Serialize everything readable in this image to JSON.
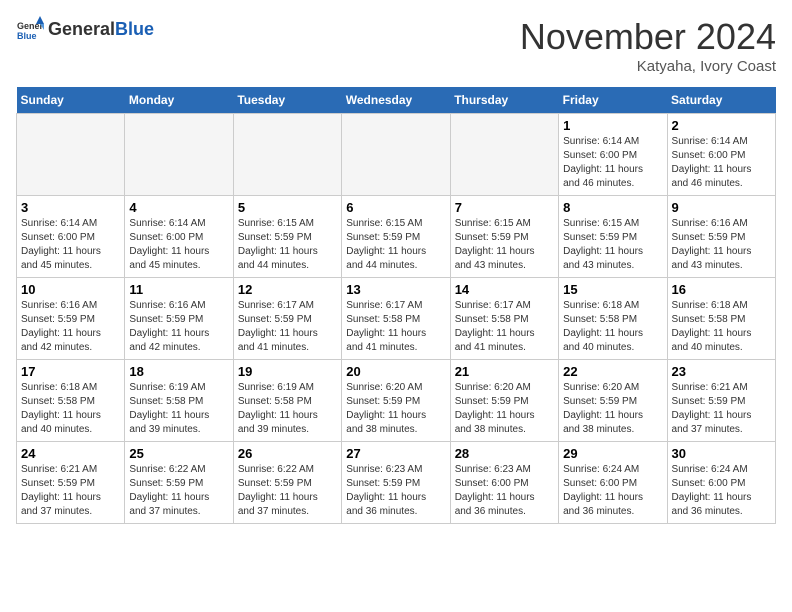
{
  "header": {
    "logo_line1": "General",
    "logo_line2": "Blue",
    "month": "November 2024",
    "location": "Katyaha, Ivory Coast"
  },
  "days_of_week": [
    "Sunday",
    "Monday",
    "Tuesday",
    "Wednesday",
    "Thursday",
    "Friday",
    "Saturday"
  ],
  "weeks": [
    [
      {
        "day": "",
        "empty": true
      },
      {
        "day": "",
        "empty": true
      },
      {
        "day": "",
        "empty": true
      },
      {
        "day": "",
        "empty": true
      },
      {
        "day": "",
        "empty": true
      },
      {
        "day": "1",
        "info": "Sunrise: 6:14 AM\nSunset: 6:00 PM\nDaylight: 11 hours\nand 46 minutes."
      },
      {
        "day": "2",
        "info": "Sunrise: 6:14 AM\nSunset: 6:00 PM\nDaylight: 11 hours\nand 46 minutes."
      }
    ],
    [
      {
        "day": "3",
        "info": "Sunrise: 6:14 AM\nSunset: 6:00 PM\nDaylight: 11 hours\nand 45 minutes."
      },
      {
        "day": "4",
        "info": "Sunrise: 6:14 AM\nSunset: 6:00 PM\nDaylight: 11 hours\nand 45 minutes."
      },
      {
        "day": "5",
        "info": "Sunrise: 6:15 AM\nSunset: 5:59 PM\nDaylight: 11 hours\nand 44 minutes."
      },
      {
        "day": "6",
        "info": "Sunrise: 6:15 AM\nSunset: 5:59 PM\nDaylight: 11 hours\nand 44 minutes."
      },
      {
        "day": "7",
        "info": "Sunrise: 6:15 AM\nSunset: 5:59 PM\nDaylight: 11 hours\nand 43 minutes."
      },
      {
        "day": "8",
        "info": "Sunrise: 6:15 AM\nSunset: 5:59 PM\nDaylight: 11 hours\nand 43 minutes."
      },
      {
        "day": "9",
        "info": "Sunrise: 6:16 AM\nSunset: 5:59 PM\nDaylight: 11 hours\nand 43 minutes."
      }
    ],
    [
      {
        "day": "10",
        "info": "Sunrise: 6:16 AM\nSunset: 5:59 PM\nDaylight: 11 hours\nand 42 minutes."
      },
      {
        "day": "11",
        "info": "Sunrise: 6:16 AM\nSunset: 5:59 PM\nDaylight: 11 hours\nand 42 minutes."
      },
      {
        "day": "12",
        "info": "Sunrise: 6:17 AM\nSunset: 5:59 PM\nDaylight: 11 hours\nand 41 minutes."
      },
      {
        "day": "13",
        "info": "Sunrise: 6:17 AM\nSunset: 5:58 PM\nDaylight: 11 hours\nand 41 minutes."
      },
      {
        "day": "14",
        "info": "Sunrise: 6:17 AM\nSunset: 5:58 PM\nDaylight: 11 hours\nand 41 minutes."
      },
      {
        "day": "15",
        "info": "Sunrise: 6:18 AM\nSunset: 5:58 PM\nDaylight: 11 hours\nand 40 minutes."
      },
      {
        "day": "16",
        "info": "Sunrise: 6:18 AM\nSunset: 5:58 PM\nDaylight: 11 hours\nand 40 minutes."
      }
    ],
    [
      {
        "day": "17",
        "info": "Sunrise: 6:18 AM\nSunset: 5:58 PM\nDaylight: 11 hours\nand 40 minutes."
      },
      {
        "day": "18",
        "info": "Sunrise: 6:19 AM\nSunset: 5:58 PM\nDaylight: 11 hours\nand 39 minutes."
      },
      {
        "day": "19",
        "info": "Sunrise: 6:19 AM\nSunset: 5:58 PM\nDaylight: 11 hours\nand 39 minutes."
      },
      {
        "day": "20",
        "info": "Sunrise: 6:20 AM\nSunset: 5:59 PM\nDaylight: 11 hours\nand 38 minutes."
      },
      {
        "day": "21",
        "info": "Sunrise: 6:20 AM\nSunset: 5:59 PM\nDaylight: 11 hours\nand 38 minutes."
      },
      {
        "day": "22",
        "info": "Sunrise: 6:20 AM\nSunset: 5:59 PM\nDaylight: 11 hours\nand 38 minutes."
      },
      {
        "day": "23",
        "info": "Sunrise: 6:21 AM\nSunset: 5:59 PM\nDaylight: 11 hours\nand 37 minutes."
      }
    ],
    [
      {
        "day": "24",
        "info": "Sunrise: 6:21 AM\nSunset: 5:59 PM\nDaylight: 11 hours\nand 37 minutes."
      },
      {
        "day": "25",
        "info": "Sunrise: 6:22 AM\nSunset: 5:59 PM\nDaylight: 11 hours\nand 37 minutes."
      },
      {
        "day": "26",
        "info": "Sunrise: 6:22 AM\nSunset: 5:59 PM\nDaylight: 11 hours\nand 37 minutes."
      },
      {
        "day": "27",
        "info": "Sunrise: 6:23 AM\nSunset: 5:59 PM\nDaylight: 11 hours\nand 36 minutes."
      },
      {
        "day": "28",
        "info": "Sunrise: 6:23 AM\nSunset: 6:00 PM\nDaylight: 11 hours\nand 36 minutes."
      },
      {
        "day": "29",
        "info": "Sunrise: 6:24 AM\nSunset: 6:00 PM\nDaylight: 11 hours\nand 36 minutes."
      },
      {
        "day": "30",
        "info": "Sunrise: 6:24 AM\nSunset: 6:00 PM\nDaylight: 11 hours\nand 36 minutes."
      }
    ]
  ]
}
